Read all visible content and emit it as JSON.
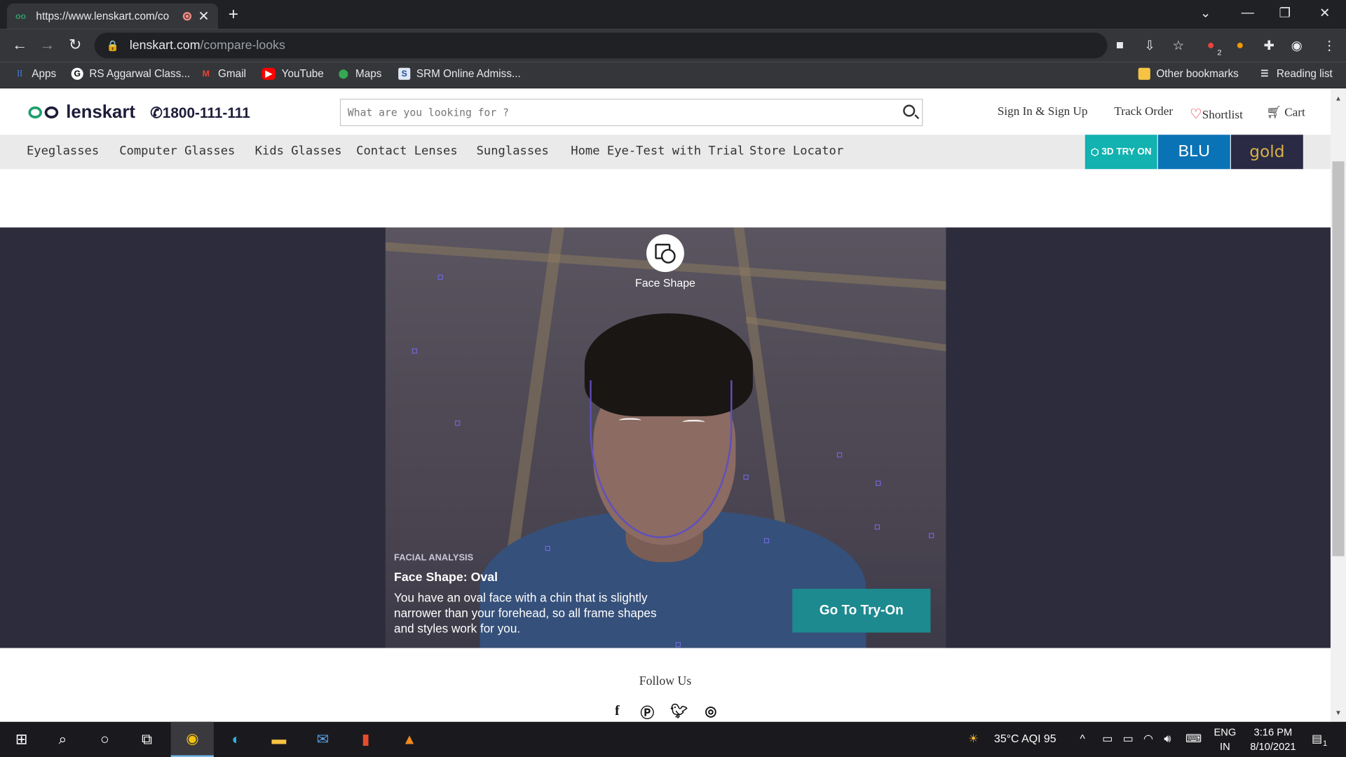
{
  "browser": {
    "tab_title": "https://www.lenskart.com/co",
    "address_host": "lenskart.com",
    "address_path": "/compare-looks",
    "bookmarks": [
      "Apps",
      "RS Aggarwal Class...",
      "Gmail",
      "YouTube",
      "Maps",
      "SRM Online Admiss..."
    ],
    "other_bookmarks": "Other bookmarks",
    "reading_list": "Reading list",
    "ext_badge": "2"
  },
  "header": {
    "logo": "lenskart",
    "phone": "1800-111-111",
    "search_placeholder": "What are you looking for ?",
    "sign_in": "Sign In & Sign Up",
    "track_order": "Track Order",
    "shortlist": "Shortlist",
    "cart": "Cart"
  },
  "nav": {
    "items": [
      "Eyeglasses",
      "Computer Glasses",
      "Kids Glasses",
      "Contact Lenses",
      "Sunglasses",
      "Home Eye-Test with Trial",
      "Store Locator"
    ],
    "promo_try": "3D TRY ON",
    "promo_blu": "BLU",
    "promo_gold": "gold"
  },
  "analysis": {
    "overlay_label": "Face Shape",
    "tag": "FACIAL ANALYSIS",
    "title": "Face Shape: Oval",
    "description": "You have an oval face with a chin that is slightly narrower than your forehead, so all frame shapes and styles work for you.",
    "cta": "Go To Try-On"
  },
  "footer": {
    "follow": "Follow Us",
    "social": [
      "facebook",
      "pinterest",
      "twitter",
      "instagram"
    ]
  },
  "taskbar": {
    "weather": "35°C AQI 95",
    "lang1": "ENG",
    "lang2": "IN",
    "time": "3:16 PM",
    "date": "8/10/2021",
    "notif": "1"
  }
}
